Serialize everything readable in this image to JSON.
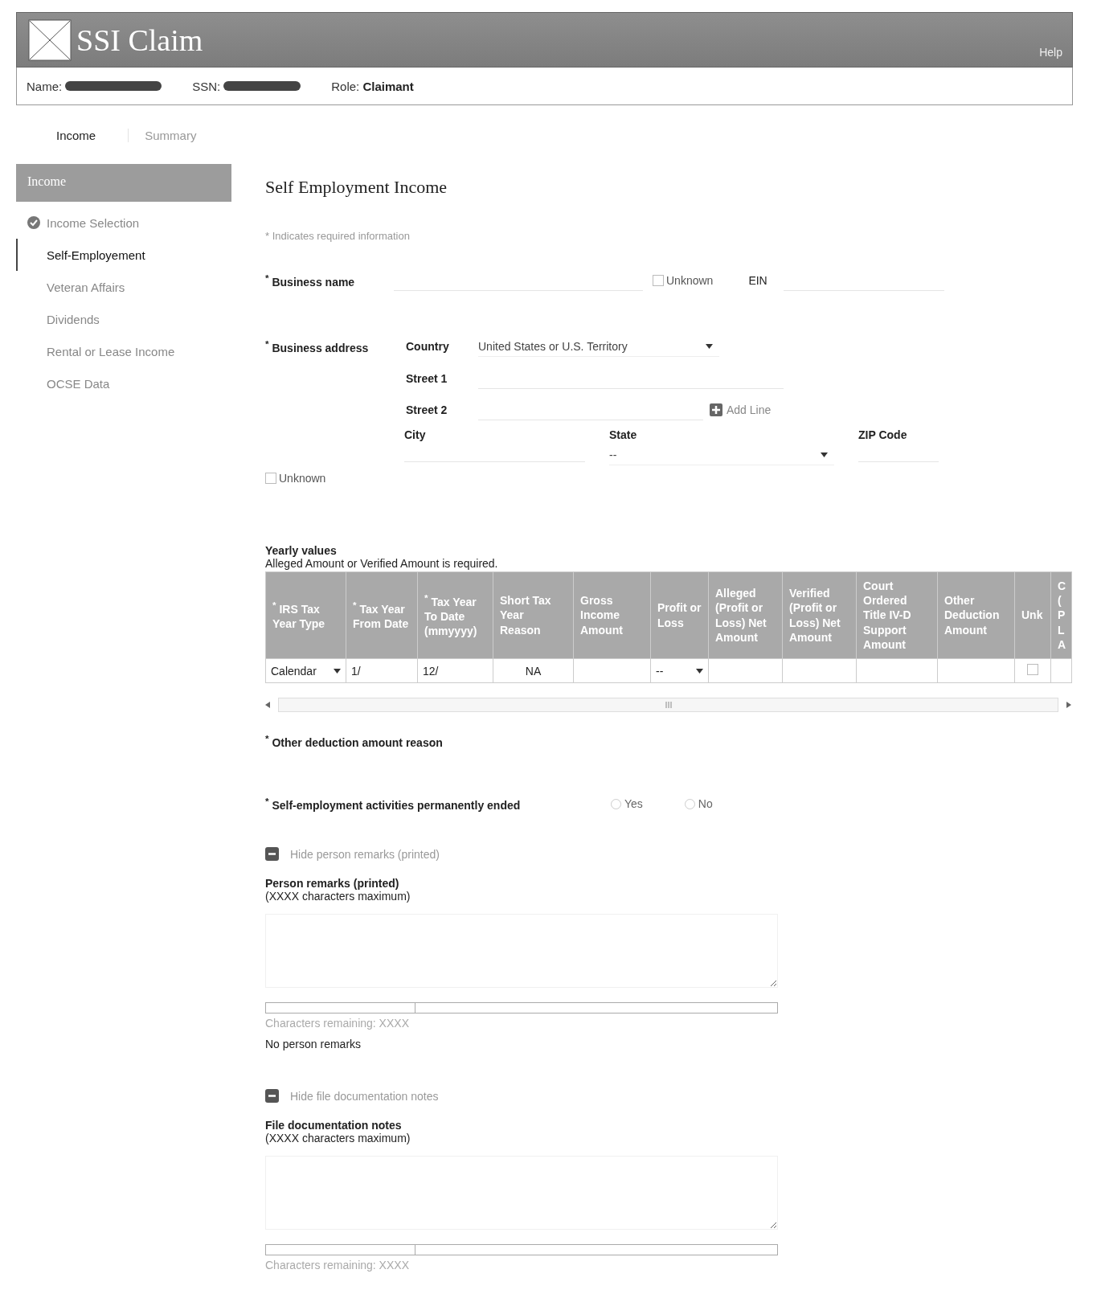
{
  "header": {
    "title": "SSI Claim",
    "help": "Help",
    "name_label": "Name:",
    "ssn_label": "SSN:",
    "role_label": "Role:",
    "role": "Claimant"
  },
  "tabs": [
    {
      "label": "Income",
      "selected": true
    },
    {
      "label": "Summary",
      "selected": false
    }
  ],
  "sidebar": {
    "title": "Income",
    "items": [
      {
        "label": "Income Selection",
        "selected": false,
        "completed": true
      },
      {
        "label": "Self-Employement",
        "selected": true,
        "completed": false
      },
      {
        "label": "Veteran Affairs",
        "selected": false,
        "completed": false
      },
      {
        "label": "Dividends",
        "selected": false,
        "completed": false
      },
      {
        "label": "Rental or Lease Income",
        "selected": false,
        "completed": false
      },
      {
        "label": "OCSE Data",
        "selected": false,
        "completed": false
      }
    ]
  },
  "page": {
    "title": "Self Employment Income",
    "required_mark": "*",
    "required_note": "Indicates required information"
  },
  "business_name": {
    "label": "Business name",
    "required": true,
    "unknown": {
      "label": "Unknown",
      "checked": false
    },
    "ein_label": "EIN"
  },
  "business_address": {
    "label": "Business address",
    "required": true,
    "country_label": "Country",
    "country": "United States or U.S. Territory",
    "street1_label": "Street 1",
    "street2_label": "Street 2",
    "add_line": "Add Line",
    "city_label": "City",
    "state_label": "State",
    "state": "--",
    "zip_label": "ZIP Code",
    "unknown": {
      "label": "Unknown",
      "checked": false
    }
  },
  "yearly": {
    "title": "Yearly values",
    "note": "Alleged Amount or Verified Amount is required.",
    "columns": [
      {
        "label": "IRS Tax Year Type",
        "required": true
      },
      {
        "label": "Tax Year From Date",
        "required": true
      },
      {
        "label": "Tax Year To Date (mmyyyy)",
        "required": true
      },
      {
        "label": "Short Tax Year Reason",
        "required": false
      },
      {
        "label": "Gross Income Amount",
        "required": false
      },
      {
        "label": "Profit or Loss",
        "required": false
      },
      {
        "label": "Alleged (Profit or Loss) Net Amount",
        "required": false
      },
      {
        "label": "Verified (Profit or Loss) Net Amount",
        "required": false
      },
      {
        "label": "Court Ordered Title IV-D Support Amount",
        "required": false
      },
      {
        "label": "Other Deduction Amount",
        "required": false
      },
      {
        "label": "Unk",
        "required": false
      },
      {
        "label": "C (P L A",
        "required": false
      }
    ],
    "row": [
      {
        "kind": "select",
        "value": "Calendar"
      },
      {
        "kind": "text",
        "value": "1/"
      },
      {
        "kind": "text",
        "value": "12/"
      },
      {
        "kind": "fixed",
        "value": "NA"
      },
      {
        "kind": "text"
      },
      {
        "kind": "select",
        "value": "--"
      },
      {
        "kind": "text"
      },
      {
        "kind": "text"
      },
      {
        "kind": "text"
      },
      {
        "kind": "text"
      },
      {
        "kind": "checkbox",
        "checked": false
      },
      {
        "kind": "text"
      }
    ]
  },
  "other_deduction": {
    "label": "Other deduction amount reason",
    "required": true
  },
  "ended": {
    "label": "Self-employment activities permanently ended",
    "required": true,
    "options": [
      {
        "label": "Yes",
        "selected": false
      },
      {
        "label": "No",
        "selected": false
      }
    ]
  },
  "remarks": [
    {
      "toggle": "Hide person remarks (printed)",
      "expanded": true,
      "title": "Person remarks (printed)",
      "limit": "(XXXX characters maximum)",
      "remaining": "Characters remaining: XXXX",
      "note": "No person remarks"
    },
    {
      "toggle": "Hide file documentation notes",
      "expanded": true,
      "title": "File documentation notes",
      "limit": "(XXXX characters maximum)",
      "remaining": "Characters remaining: XXXX"
    }
  ]
}
